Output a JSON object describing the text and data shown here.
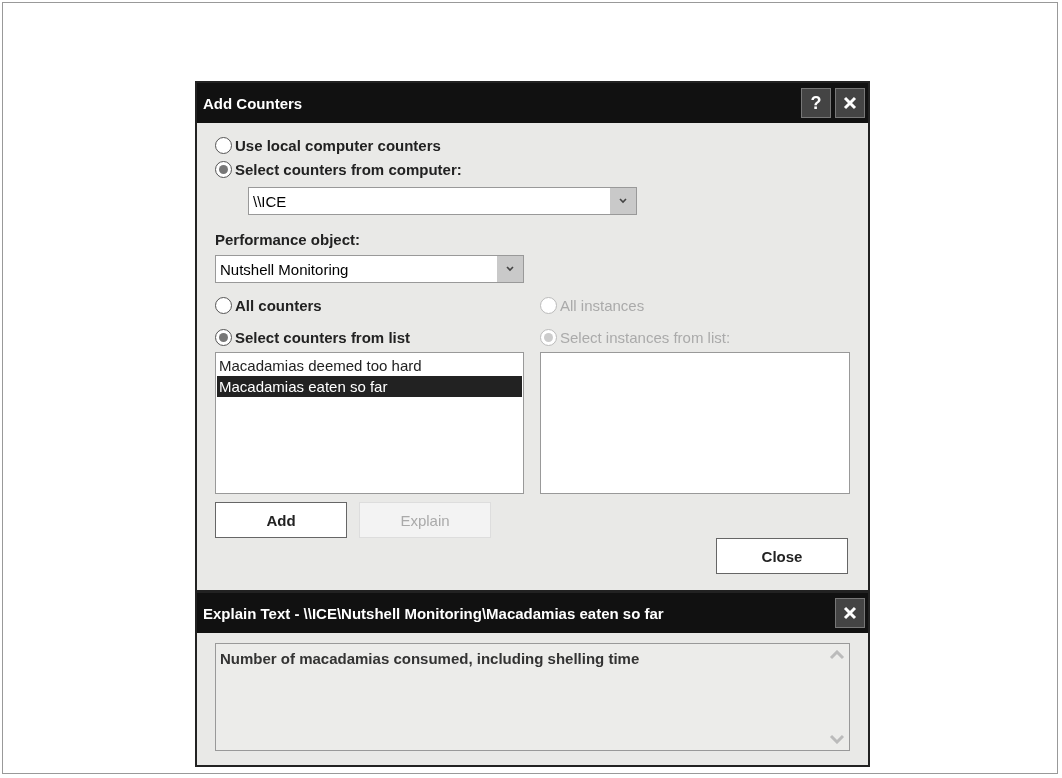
{
  "add_counters": {
    "title": "Add Counters",
    "help_button": "?",
    "computer_source": [
      {
        "label": "Use local computer counters",
        "selected": false
      },
      {
        "label": "Select counters from computer:",
        "selected": true
      }
    ],
    "computer": {
      "value": "\\\\ICE"
    },
    "performance_object": {
      "label": "Performance object:",
      "value": "Nutshell Monitoring"
    },
    "counter_source": [
      {
        "label": "All counters",
        "selected": false
      },
      {
        "label": "Select counters from list",
        "selected": true
      }
    ],
    "counters": [
      {
        "label": "Macadamias deemed too hard",
        "selected": false
      },
      {
        "label": "Macadamias eaten so far",
        "selected": true
      }
    ],
    "instances_disabled": true,
    "instance_source": [
      {
        "label": "All instances",
        "selected": false
      },
      {
        "label": "Select instances from list:",
        "selected": true
      }
    ],
    "buttons": [
      {
        "label": "Add",
        "disabled": false
      },
      {
        "label": "Explain",
        "disabled": true
      }
    ],
    "close_button": "Close"
  },
  "explain_text": {
    "title": "Explain Text - \\\\ICE\\Nutshell Monitoring\\Macadamias eaten so far",
    "text": "Number of macadamias consumed, including shelling time"
  }
}
